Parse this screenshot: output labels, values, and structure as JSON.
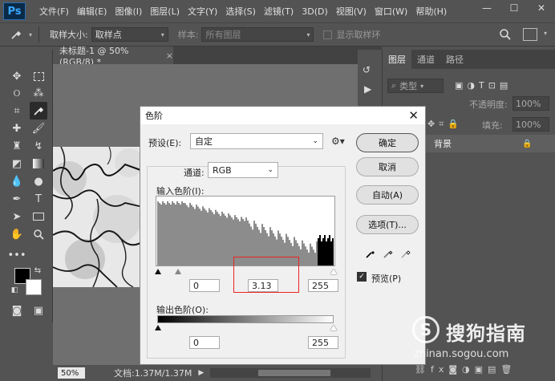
{
  "app": {
    "logo": "Ps"
  },
  "menu": [
    "文件(F)",
    "编辑(E)",
    "图像(I)",
    "图层(L)",
    "文字(Y)",
    "选择(S)",
    "滤镜(T)",
    "3D(D)",
    "视图(V)",
    "窗口(W)",
    "帮助(H)"
  ],
  "window_controls": {
    "minimize": "—",
    "maximize": "☐",
    "close": "✕"
  },
  "options_bar": {
    "sample_size_label": "取样大小:",
    "sample_size_value": "取样点",
    "sample_label": "样本:",
    "sample_value": "所有图层",
    "show_ring_label": "显示取样环"
  },
  "document": {
    "tab_title": "未标题-1 @ 50%(RGB/8) *",
    "tab_close": "×",
    "zoom": "50%",
    "doc_size": "文档:1.37M/1.37M"
  },
  "panels": {
    "tabs": [
      "图层",
      "通道",
      "路径"
    ],
    "kind_label": "类型",
    "opacity_label": "不透明度:",
    "opacity_value": "100%",
    "fill_label": "填充:",
    "fill_value": "100%",
    "layer_name": "背景"
  },
  "dialog": {
    "title": "色阶",
    "close": "✕",
    "preset_label": "预设(E):",
    "preset_value": "自定",
    "channel_label": "通道:",
    "channel_value": "RGB",
    "input_levels_label": "输入色阶(I):",
    "input_black": "0",
    "input_gamma": "3.13",
    "input_white": "255",
    "output_levels_label": "输出色阶(O):",
    "output_black": "0",
    "output_white": "255",
    "buttons": {
      "ok": "确定",
      "cancel": "取消",
      "auto": "自动(A)",
      "options": "选项(T)..."
    },
    "preview_label": "预览(P)"
  },
  "watermark": {
    "brand": "搜狗指南",
    "url": "zhinan.sogou.com"
  },
  "colors": {
    "ui_bg": "#535353",
    "dialog_bg": "#f0f0f0",
    "highlight": "#e22222",
    "ps_blue": "#3aa8ff"
  }
}
